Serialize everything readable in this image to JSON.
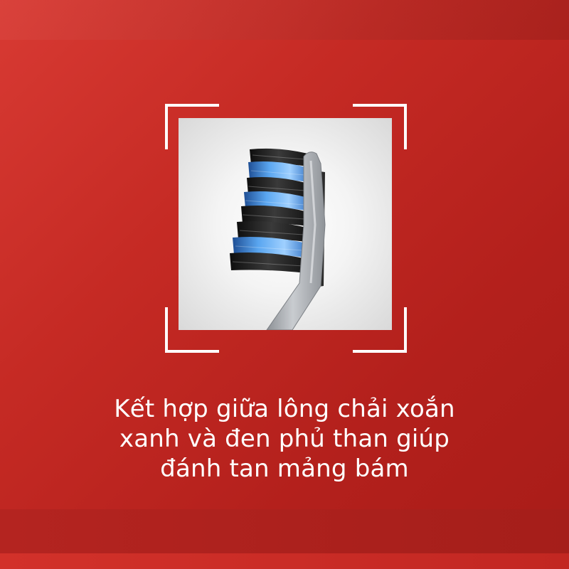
{
  "caption": {
    "lines": [
      "Kết hợp giữa lông chải xoắn",
      "xanh và đen phủ than giúp",
      "đánh tan mảng bám"
    ]
  },
  "image": {
    "subject": "toothbrush-head-icon"
  },
  "colors": {
    "background": "#b8221e",
    "frame": "#ffffff",
    "bristle_blue": "#3d8be0",
    "bristle_black": "#1c1c1c",
    "handle": "#a9adb1"
  }
}
